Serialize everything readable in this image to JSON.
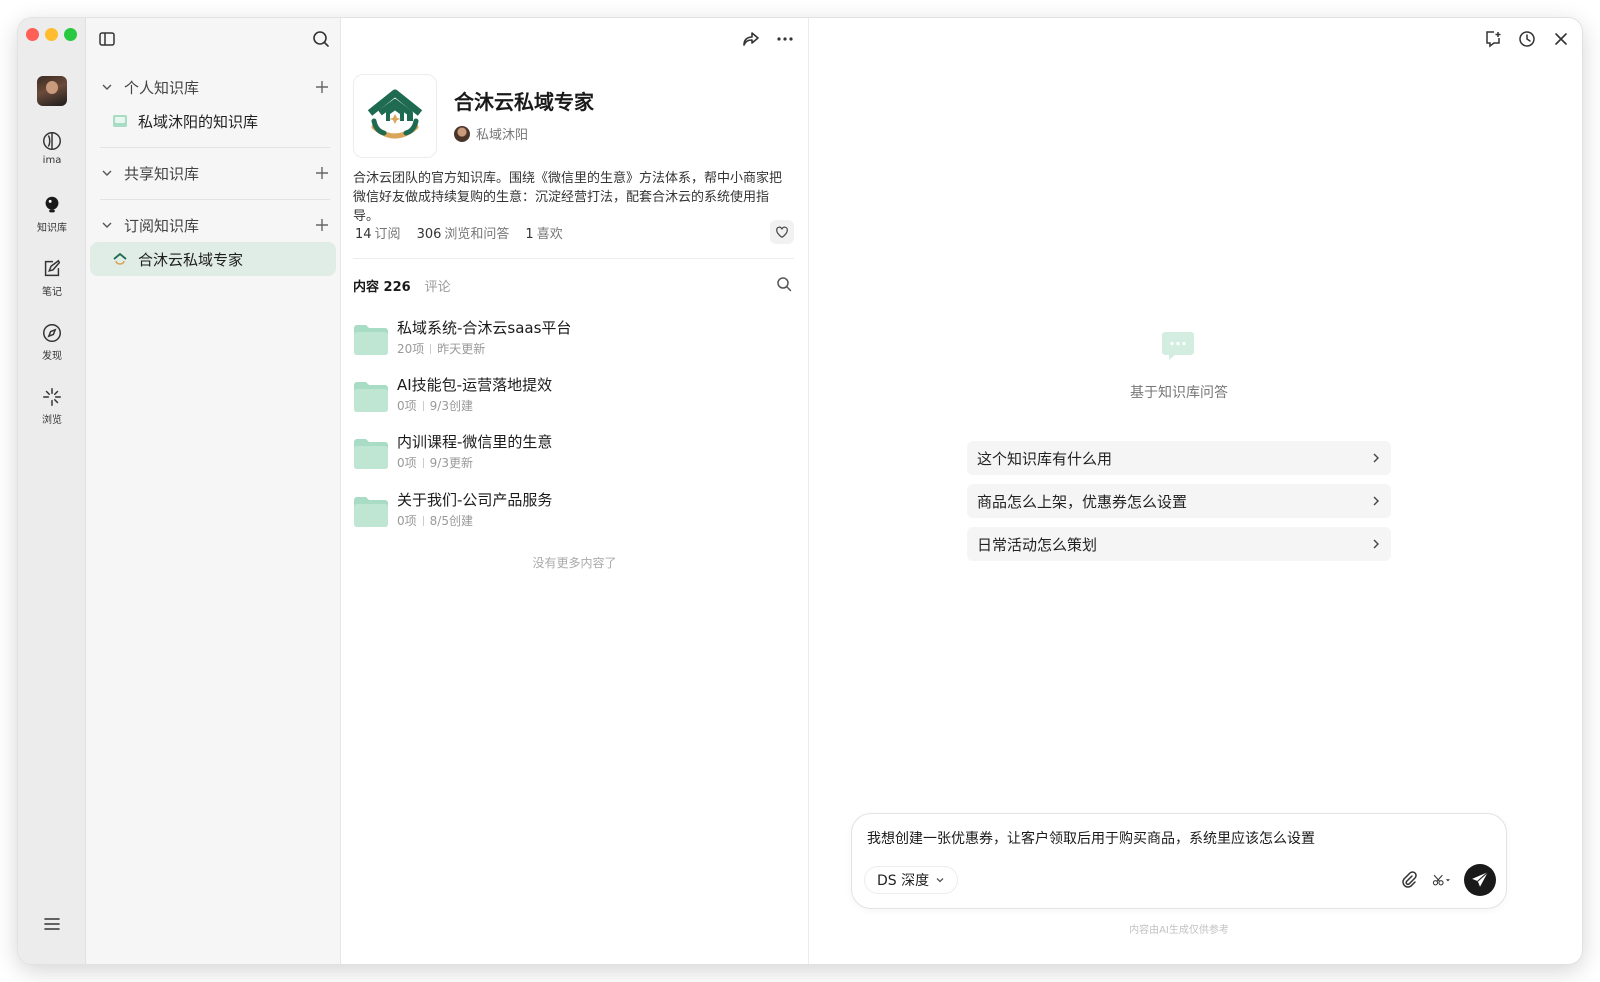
{
  "rail": {
    "items": [
      {
        "label": "ima",
        "icon": "ima-icon"
      },
      {
        "label": "知识库",
        "icon": "bulb-icon"
      },
      {
        "label": "笔记",
        "icon": "note-icon"
      },
      {
        "label": "发现",
        "icon": "compass-icon"
      },
      {
        "label": "浏览",
        "icon": "sparkle-icon"
      }
    ]
  },
  "sidebar": {
    "personal": {
      "title": "个人知识库",
      "items": [
        "私域沐阳的知识库"
      ]
    },
    "shared": {
      "title": "共享知识库"
    },
    "subscribed": {
      "title": "订阅知识库",
      "items": [
        "合沐云私域专家"
      ]
    }
  },
  "kb": {
    "title": "合沐云私域专家",
    "author": "私域沐阳",
    "description": "合沐云团队的官方知识库。围绕《微信里的生意》方法体系，帮中小商家把微信好友做成持续复购的生意：沉淀经营打法，配套合沐云的系统使用指导。",
    "stats": [
      {
        "num": "14",
        "label": "订阅"
      },
      {
        "num": "306",
        "label": "浏览和问答"
      },
      {
        "num": "1",
        "label": "喜欢"
      }
    ],
    "tab_content": "内容 226",
    "tab_comments": "评论",
    "folders": [
      {
        "name": "私域系统-合沐云saas平台",
        "count": "20项",
        "date": "昨天更新"
      },
      {
        "name": "AI技能包-运营落地提效",
        "count": "0项",
        "date": "9/3创建"
      },
      {
        "name": "内训课程-微信里的生意",
        "count": "0项",
        "date": "9/3更新"
      },
      {
        "name": "关于我们-公司产品服务",
        "count": "0项",
        "date": "8/5创建"
      }
    ],
    "no_more": "没有更多内容了"
  },
  "chat": {
    "empty_label": "基于知识库问答",
    "suggestions": [
      "这个知识库有什么用",
      "商品怎么上架，优惠券怎么设置",
      "日常活动怎么策划"
    ],
    "input_value": "我想创建一张优惠券，让客户领取后用于购买商品，系统里应该怎么设置",
    "model": "DS 深度",
    "disclaimer": "内容由AI生成仅供参考"
  },
  "colors": {
    "brand_green": "#1f6b52",
    "brand_gold": "#d9a55a",
    "active_bg": "#e0ece6",
    "folder_green": "#a8dcc4"
  }
}
